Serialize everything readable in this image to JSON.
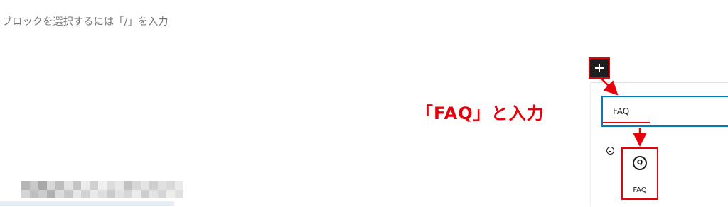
{
  "editor": {
    "placeholder": "ブロックを選択するには「/」を入力"
  },
  "inserter": {
    "add_button_icon": "plus-icon",
    "search_value": "FAQ",
    "recent_icon": "clock-icon",
    "results": [
      {
        "label": "FAQ",
        "icon": "faq-block-icon",
        "icon_glyph": "Q"
      }
    ]
  },
  "annotation": {
    "callout_text": "「FAQ」と入力",
    "color": "#e8000b"
  },
  "colors": {
    "accent": "#007cba",
    "annotation_red": "#e8000b",
    "button_dark": "#1e1e1e"
  }
}
